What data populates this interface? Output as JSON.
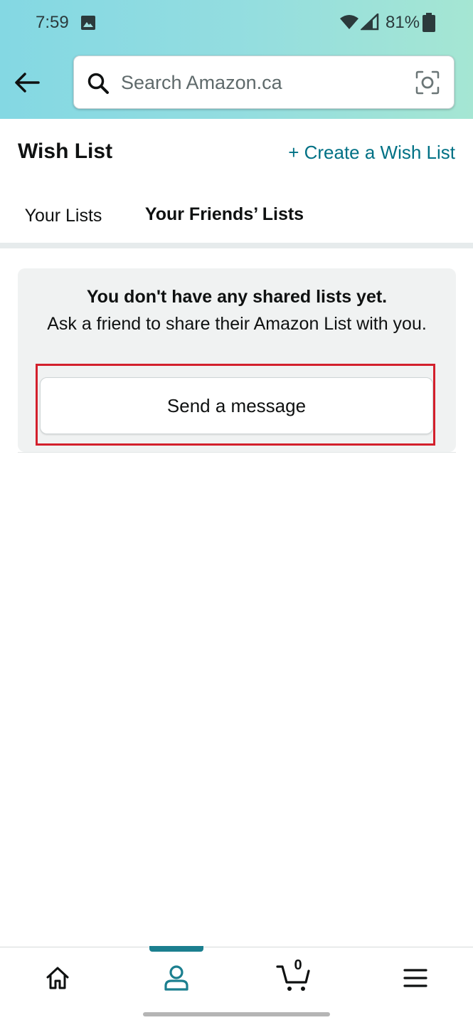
{
  "status_bar": {
    "time": "7:59",
    "battery_percent": "81%",
    "icons": [
      "photo-icon",
      "wifi-icon",
      "signal-icon",
      "battery-icon"
    ]
  },
  "header": {
    "back_icon": "arrow-left-icon",
    "search": {
      "placeholder": "Search Amazon.ca",
      "value": "",
      "search_icon": "search-icon",
      "camera_icon": "camera-icon"
    },
    "gradient_colors": [
      "#84d8e3",
      "#a5e6d3"
    ]
  },
  "page": {
    "title": "Wish List",
    "create_link": "+ Create a Wish List",
    "link_color": "#007185"
  },
  "tabs": [
    {
      "label": "Your Lists",
      "active": false
    },
    {
      "label": "Your Friends’ Lists",
      "active": true
    }
  ],
  "empty_state": {
    "heading": "You don't have any shared lists yet.",
    "message": "Ask a friend to share their Amazon List with you.",
    "button_label": "Send a message",
    "highlight_color": "#d3202c"
  },
  "bottom_nav": {
    "items": [
      {
        "icon": "home-icon",
        "active": false
      },
      {
        "icon": "account-icon",
        "active": true
      },
      {
        "icon": "cart-icon",
        "active": false,
        "count": "0"
      },
      {
        "icon": "menu-icon",
        "active": false
      }
    ],
    "active_color": "#1b7f8f"
  },
  "accent_color": "#e88a2a"
}
